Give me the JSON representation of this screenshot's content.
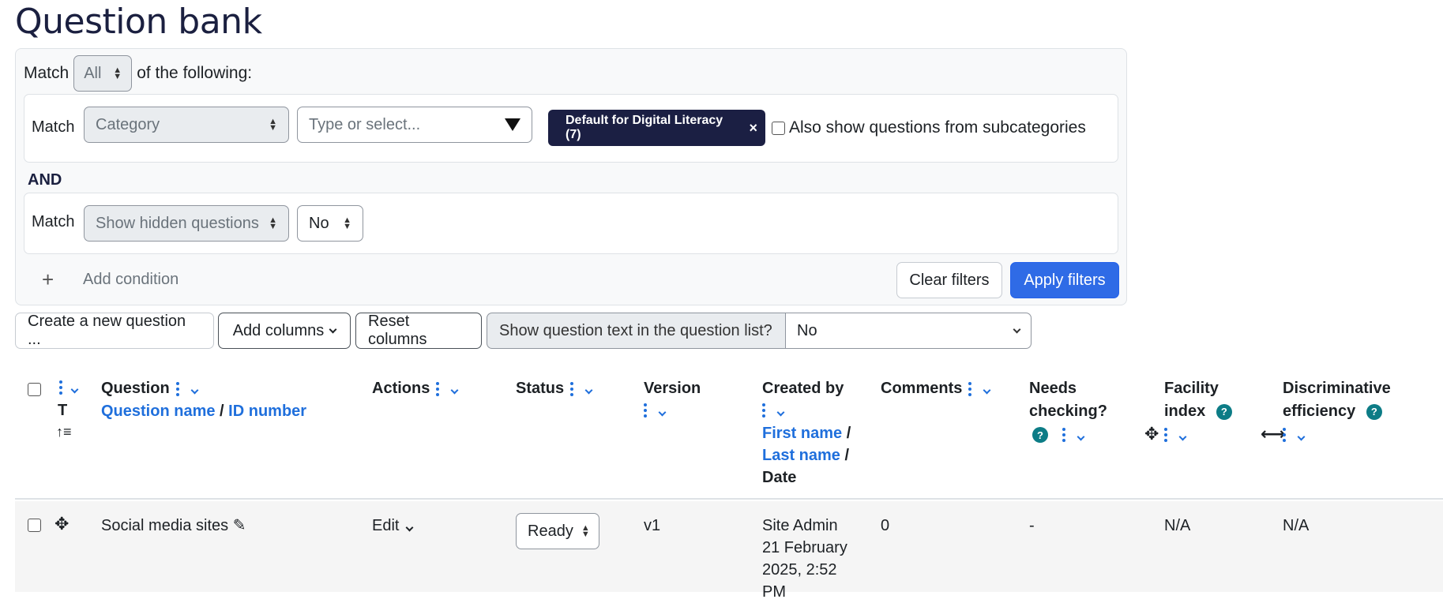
{
  "page": {
    "title": "Question bank"
  },
  "filters": {
    "match_label": "Match",
    "match_value": "All",
    "of_following": "of the following:",
    "condition1": {
      "match_label": "Match",
      "field": "Category",
      "input_placeholder": "Type or select...",
      "chip_label": "Default for Digital Literacy (7)",
      "chip_close": "×",
      "subcategory_label": "Also show questions from subcategories"
    },
    "join": "AND",
    "condition2": {
      "match_label": "Match",
      "field": "Show hidden questions",
      "value": "No"
    },
    "add_condition_icon": "+",
    "add_condition": "Add condition",
    "clear": "Clear filters",
    "apply": "Apply filters"
  },
  "toolbar": {
    "create": "Create a new question ...",
    "add_columns": "Add columns",
    "reset_columns": "Reset columns",
    "show_text_label": "Show question text in the question list?",
    "show_text_value": "No"
  },
  "table": {
    "headers": {
      "type_t": "T",
      "question": "Question",
      "question_name": "Question name",
      "slash": "/",
      "id_number": "ID number",
      "actions": "Actions",
      "status": "Status",
      "version": "Version",
      "created_by": "Created by",
      "first_name": "First name",
      "last_name": "Last name",
      "date": "Date",
      "comments": "Comments",
      "needs_checking_1": "Needs",
      "needs_checking_2": "checking?",
      "facility_1": "Facility",
      "facility_2": "index",
      "disc_1": "Discriminative",
      "disc_2": "efficiency",
      "help": "?"
    },
    "rows": [
      {
        "question": "Social media sites",
        "action": "Edit",
        "status": "Ready",
        "version": "v1",
        "created_by_1": "Site Admin",
        "created_by_2": "21 February",
        "created_by_3": "2025, 2:52",
        "created_by_4": "PM",
        "comments": "0",
        "needs_checking": "-",
        "facility": "N/A",
        "discriminative": "N/A"
      }
    ]
  },
  "colors": {
    "primary": "#2f6be6",
    "chip": "#1b1f43",
    "link": "#1f6fdc",
    "help": "#0c7c86"
  }
}
